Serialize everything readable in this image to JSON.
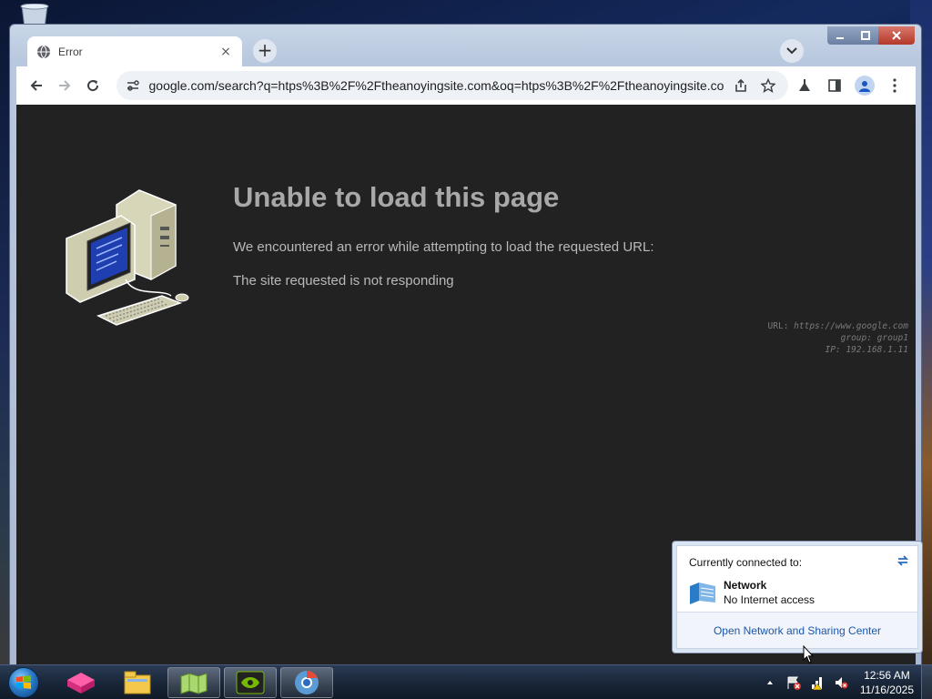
{
  "browser": {
    "tab": {
      "title": "Error",
      "close": "×"
    },
    "new_tab": "+",
    "address": "google.com/search?q=htps%3B%2F%2Ftheanoyingsite.com&oq=htps%3B%2F%2Ftheanoyingsite.com...",
    "icons": [
      "back-icon",
      "forward-icon",
      "reload-icon",
      "site-info-icon",
      "share-icon",
      "bookmark-star-icon",
      "labs-icon",
      "side-panel-icon",
      "profile-icon",
      "menu-icon"
    ]
  },
  "error_page": {
    "title": "Unable to load this page",
    "line1": "We encountered an error while attempting to load the requested URL:",
    "line2": "The site requested is not responding",
    "info": {
      "url_label": "URL: ",
      "url_value": "https://www.google.com",
      "group_label": "group: ",
      "group_value": "group1",
      "ip_label": "IP: ",
      "ip_value": "192.168.1.11"
    }
  },
  "network_flyout": {
    "heading": "Currently connected to:",
    "network_name": "Network",
    "network_status": "No Internet access",
    "link": "Open Network and Sharing Center"
  },
  "taskbar": {
    "time": "12:56 AM",
    "date": "11/16/2025"
  }
}
